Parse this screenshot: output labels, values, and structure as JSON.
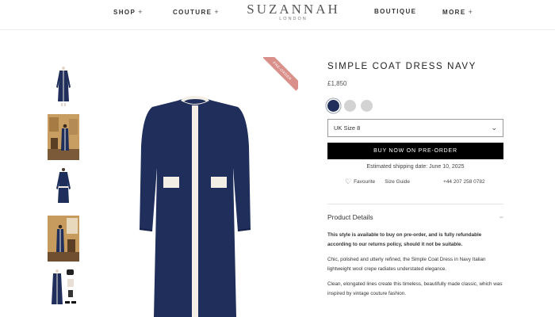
{
  "brand": {
    "name": "SUZANNAH",
    "location": "LONDON"
  },
  "nav": {
    "shop": "SHOP",
    "couture": "COUTURE",
    "boutique": "BOUTIQUE",
    "more": "MORE",
    "plus": "+"
  },
  "ribbon": {
    "label": "PRE-ORDER"
  },
  "product": {
    "title": "SIMPLE COAT DRESS NAVY",
    "price": "£1,850",
    "colors": [
      "#1f2e5a",
      "#d3d3d3",
      "#d3d3d3"
    ],
    "size_selected": "UK Size 8",
    "buy_label": "BUY NOW ON PRE-ORDER",
    "shipping": "Estimated shipping date: June 10, 2025",
    "favourite": "Favourite",
    "size_guide": "Size Guide",
    "phone": "+44 207 258 0782"
  },
  "details": {
    "heading": "Product Details",
    "toggle": "−",
    "paragraphs": [
      "This style is available to buy on pre-order, and is fully refundable according to our returns policy, should it not be suitable.",
      "Chic, polished and utterly refined, the Simple Coat Dress in Navy Italian lightweight wool crepe radiates understated elegance.",
      "Clean, elongated lines create this timeless, beautifully made classic, which was inspired by vintage couture fashion."
    ]
  }
}
